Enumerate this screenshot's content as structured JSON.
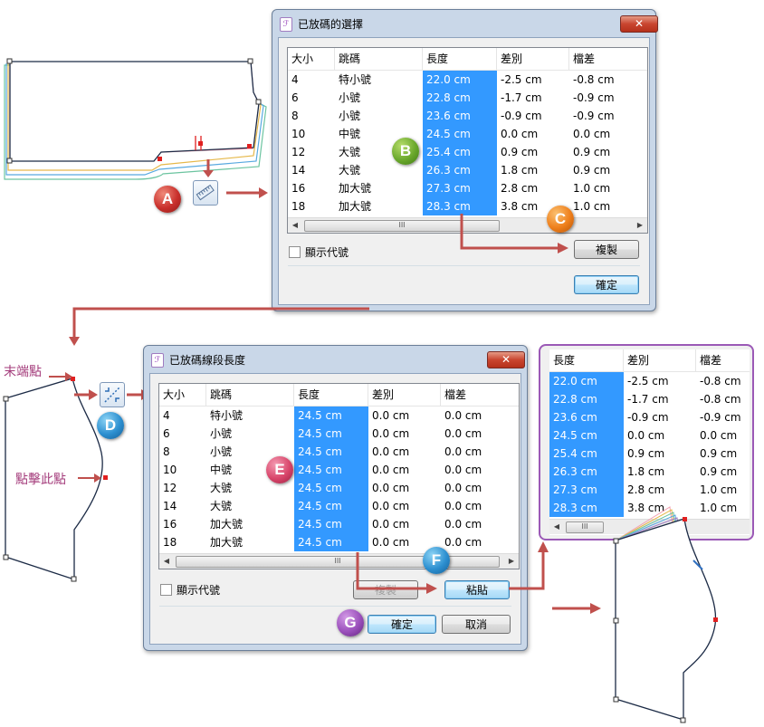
{
  "dialog1": {
    "title": "已放碼的選擇",
    "close_label": "✕",
    "headers": [
      "大小",
      "跳碼",
      "長度",
      "差別",
      "檔差"
    ],
    "rows": [
      [
        "4",
        "特小號",
        "22.0 cm",
        "-2.5 cm",
        "-0.8 cm"
      ],
      [
        "6",
        "小號",
        "22.8 cm",
        "-1.7 cm",
        "-0.9 cm"
      ],
      [
        "8",
        "小號",
        "23.6 cm",
        "-0.9 cm",
        "-0.9 cm"
      ],
      [
        "10",
        "中號",
        "24.5 cm",
        "0.0 cm",
        "0.0 cm"
      ],
      [
        "12",
        "大號",
        "25.4 cm",
        "0.9 cm",
        "0.9 cm"
      ],
      [
        "14",
        "大號",
        "26.3 cm",
        "1.8 cm",
        "0.9 cm"
      ],
      [
        "16",
        "加大號",
        "27.3 cm",
        "2.8 cm",
        "1.0 cm"
      ],
      [
        "18",
        "加大號",
        "28.3 cm",
        "3.8 cm",
        "1.0 cm"
      ]
    ],
    "show_code_label": "顯示代號",
    "copy_button": "複製",
    "ok_button": "確定"
  },
  "dialog2": {
    "title": "已放碼線段長度",
    "close_label": "✕",
    "headers": [
      "大小",
      "跳碼",
      "長度",
      "差別",
      "檔差"
    ],
    "rows": [
      [
        "4",
        "特小號",
        "24.5 cm",
        "0.0 cm",
        "0.0 cm"
      ],
      [
        "6",
        "小號",
        "24.5 cm",
        "0.0 cm",
        "0.0 cm"
      ],
      [
        "8",
        "小號",
        "24.5 cm",
        "0.0 cm",
        "0.0 cm"
      ],
      [
        "10",
        "中號",
        "24.5 cm",
        "0.0 cm",
        "0.0 cm"
      ],
      [
        "12",
        "大號",
        "24.5 cm",
        "0.0 cm",
        "0.0 cm"
      ],
      [
        "14",
        "大號",
        "24.5 cm",
        "0.0 cm",
        "0.0 cm"
      ],
      [
        "16",
        "加大號",
        "24.5 cm",
        "0.0 cm",
        "0.0 cm"
      ],
      [
        "18",
        "加大號",
        "24.5 cm",
        "0.0 cm",
        "0.0 cm"
      ]
    ],
    "show_code_label": "顯示代號",
    "copy_button": "複製",
    "paste_button": "粘貼",
    "ok_button": "確定",
    "cancel_button": "取消"
  },
  "popup": {
    "headers": [
      "長度",
      "差別",
      "檔差"
    ],
    "rows": [
      [
        "22.0 cm",
        "-2.5 cm",
        "-0.8 cm"
      ],
      [
        "22.8 cm",
        "-1.7 cm",
        "-0.8 cm"
      ],
      [
        "23.6 cm",
        "-0.9 cm",
        "-0.9 cm"
      ],
      [
        "24.5 cm",
        "0.0 cm",
        "0.0 cm"
      ],
      [
        "25.4 cm",
        "0.9 cm",
        "0.9 cm"
      ],
      [
        "26.3 cm",
        "1.8 cm",
        "0.9 cm"
      ],
      [
        "27.3 cm",
        "2.8 cm",
        "1.0 cm"
      ],
      [
        "28.3 cm",
        "3.8 cm",
        "1.0 cm"
      ]
    ]
  },
  "scroll_thumb_glyph": "III",
  "badges": {
    "a": "A",
    "b": "B",
    "c": "C",
    "d": "D",
    "e": "E",
    "f": "F",
    "g": "G"
  },
  "labels": {
    "end_point": "末端點",
    "click_point": "點擊此點"
  },
  "icons": {
    "measure_tool": "ruler-icon",
    "graded_segment_tool": "segment-length-icon"
  },
  "colors": {
    "selection": "#3399ff",
    "annotation_arrow": "#c0504d",
    "popup_border": "#9b59b6"
  }
}
